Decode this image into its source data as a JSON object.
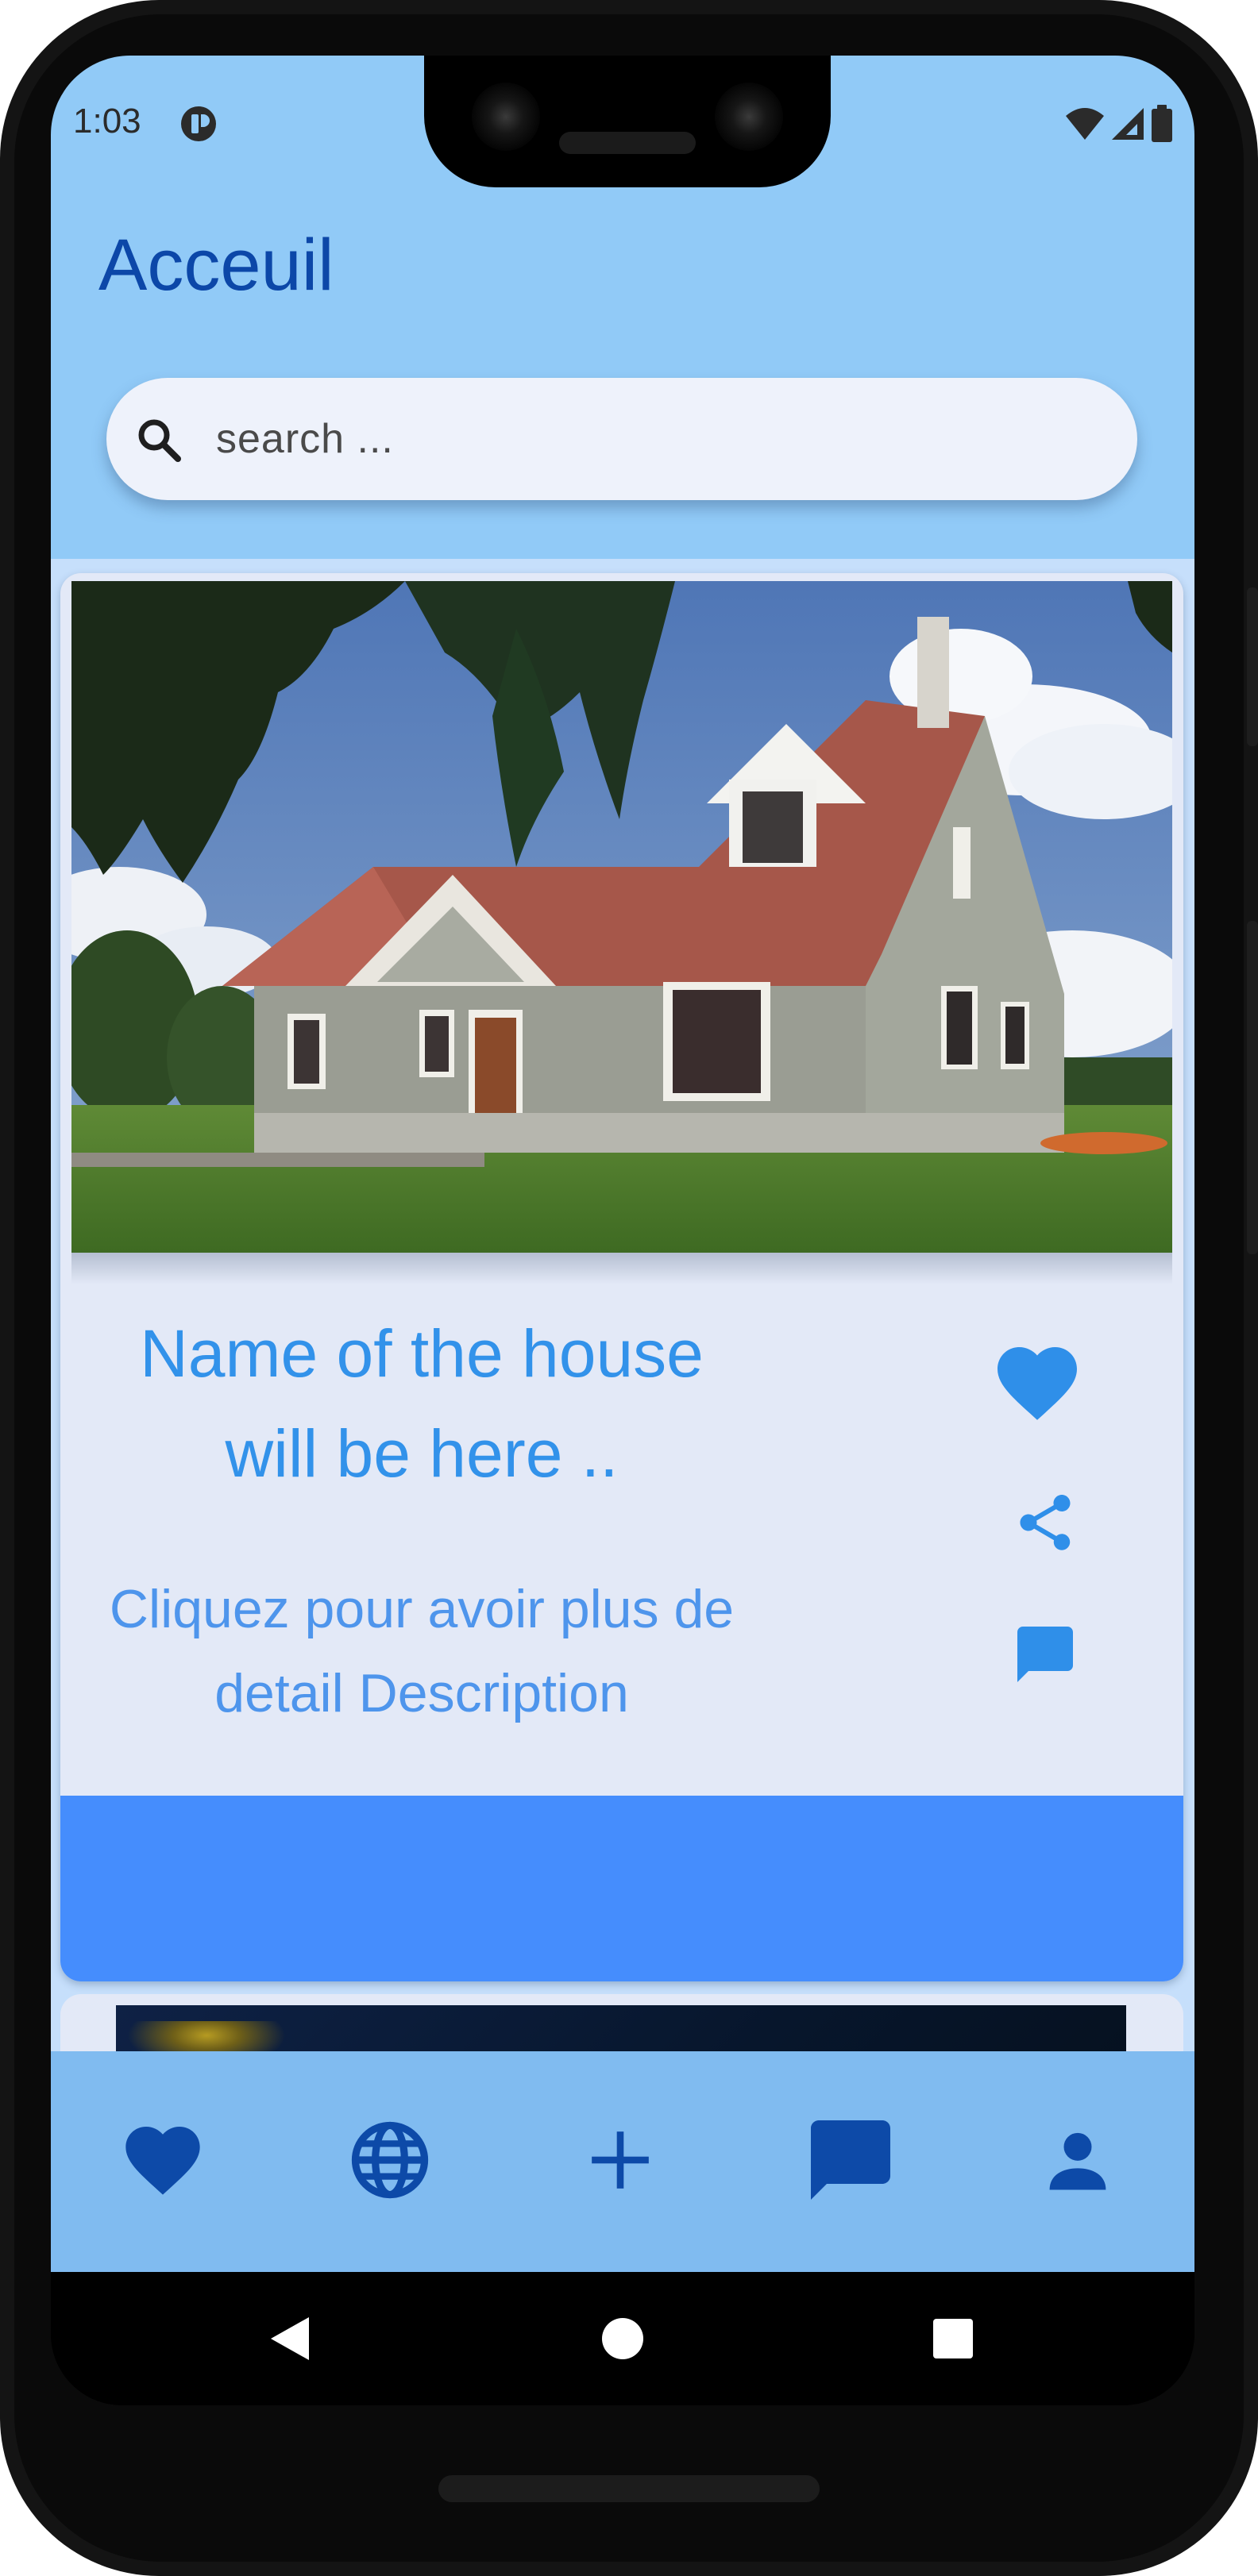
{
  "status_bar": {
    "time": "1:03"
  },
  "header": {
    "title": "Acceuil"
  },
  "search": {
    "placeholder": "search ..."
  },
  "listing": {
    "name": "Name of the house will be here ..",
    "description": "Cliquez pour avoir plus de detail Description",
    "actions": [
      "heart-icon",
      "share-icon",
      "comment-icon"
    ]
  },
  "bottom_nav": {
    "items": [
      "favorites-heart-icon",
      "globe-icon",
      "add-plus-icon",
      "messages-chat-icon",
      "profile-person-icon"
    ]
  },
  "colors": {
    "app_bar": "#91caf7",
    "content_bg": "#c6dffb",
    "card_bg": "#e3e9f7",
    "title": "#0c47a8",
    "accent": "#3292ea",
    "banner": "#458dfd",
    "bottom_nav": "#80bbf0",
    "nav_icon": "#0d4aa8"
  }
}
